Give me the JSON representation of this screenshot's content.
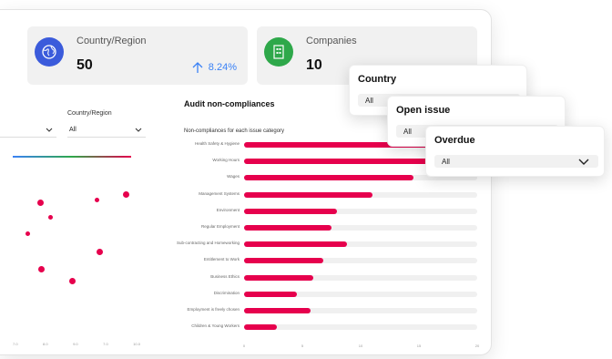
{
  "kpis": {
    "country": {
      "label": "Country/Region",
      "value": "50",
      "delta": "8.24%",
      "icon": "globe-icon",
      "color": "#3b5bdb"
    },
    "companies": {
      "label": "Companies",
      "value": "10",
      "icon": "building-icon",
      "color": "#2ea84a"
    }
  },
  "left_panel": {
    "filter_label": "Country/Region",
    "filter_value": "All",
    "ticks": [
      "7.0",
      "8.0",
      "9.0",
      "7.0",
      "10.0"
    ]
  },
  "audit": {
    "title": "Audit non-compliances",
    "subtitle": "Non-compliances for each issue category",
    "bar_color": "#e6004d"
  },
  "chart_data": {
    "type": "bar",
    "orientation": "horizontal",
    "categories": [
      "Health Safety & Hygiene",
      "Working Hours",
      "Wages",
      "Management Systems",
      "Environment",
      "Regular Employment",
      "Sub-contracting and Homeworking",
      "Entitlement to Work",
      "Business Ethics",
      "Discrimination",
      "Employment is freely chosen",
      "Children & Young Workers"
    ],
    "values": [
      20,
      20,
      14.5,
      11,
      8,
      7.5,
      8.8,
      6.8,
      5.9,
      4.5,
      5.7,
      2.8
    ],
    "xlim": [
      0,
      20
    ],
    "xticks": [
      "0",
      "5",
      "10",
      "15",
      "20"
    ]
  },
  "filters": {
    "country": {
      "title": "Country",
      "value": "All"
    },
    "open_issue": {
      "title": "Open issue",
      "value": "All"
    },
    "overdue": {
      "title": "Overdue",
      "value": "All"
    }
  }
}
